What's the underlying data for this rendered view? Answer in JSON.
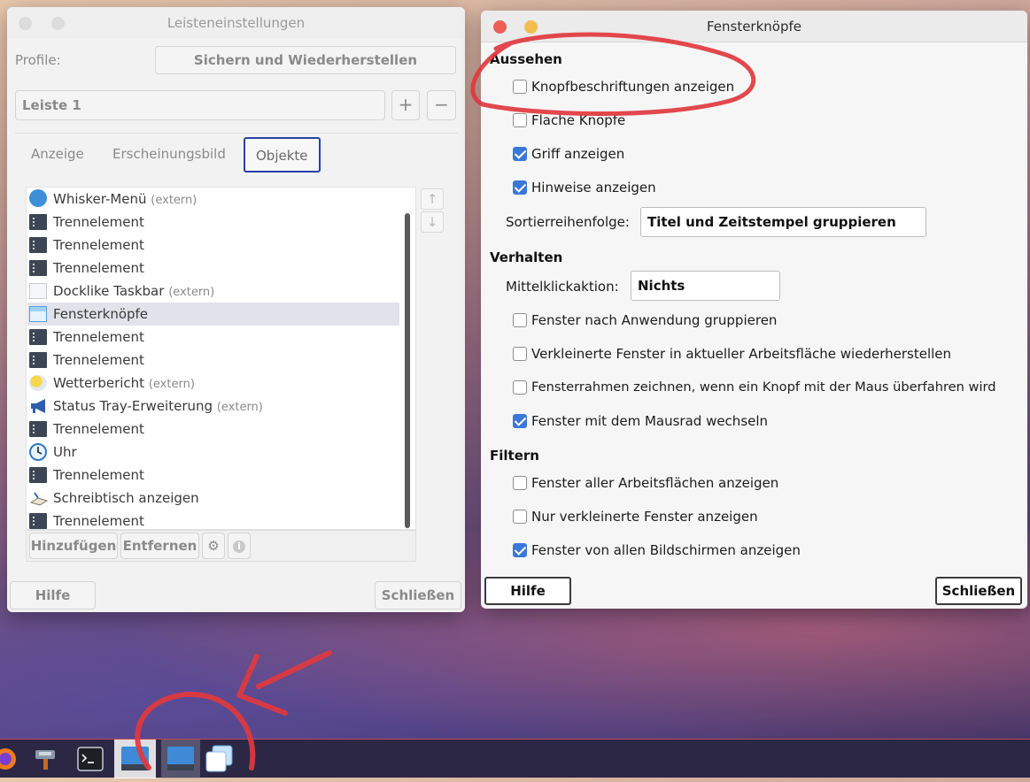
{
  "left_window": {
    "title": "Leisteneinstellungen",
    "profile_label": "Profile:",
    "backup_button": "Sichern und Wiederherstellen",
    "panel_select": "Leiste 1",
    "add_symbol": "+",
    "remove_symbol": "−",
    "tabs": [
      "Anzeige",
      "Erscheinungsbild",
      "Objekte"
    ],
    "active_tab": "Objekte",
    "items": [
      {
        "label": "Whisker-Menü",
        "extra": "(extern)",
        "icon": "whisker-menu-icon"
      },
      {
        "label": "Trennelement",
        "extra": "",
        "icon": "separator-icon"
      },
      {
        "label": "Trennelement",
        "extra": "",
        "icon": "separator-icon"
      },
      {
        "label": "Trennelement",
        "extra": "",
        "icon": "separator-icon"
      },
      {
        "label": "Docklike Taskbar",
        "extra": "(extern)",
        "icon": "taskbar-icon"
      },
      {
        "label": "Fensterknöpfe",
        "extra": "",
        "icon": "window-buttons-icon"
      },
      {
        "label": "Trennelement",
        "extra": "",
        "icon": "separator-icon"
      },
      {
        "label": "Trennelement",
        "extra": "",
        "icon": "separator-icon"
      },
      {
        "label": "Wetterbericht",
        "extra": "(extern)",
        "icon": "weather-icon"
      },
      {
        "label": "Status Tray-Erweiterung",
        "extra": "(extern)",
        "icon": "megaphone-icon"
      },
      {
        "label": "Trennelement",
        "extra": "",
        "icon": "separator-icon"
      },
      {
        "label": "Uhr",
        "extra": "",
        "icon": "clock-icon"
      },
      {
        "label": "Trennelement",
        "extra": "",
        "icon": "separator-icon"
      },
      {
        "label": "Schreibtisch anzeigen",
        "extra": "",
        "icon": "show-desktop-icon"
      },
      {
        "label": "Trennelement",
        "extra": "",
        "icon": "separator-icon"
      }
    ],
    "selected_item": "Fensterknöpfe",
    "add_item_button": "Hinzufügen",
    "remove_item_button": "Entfernen",
    "help_button": "Hilfe",
    "close_button": "Schließen"
  },
  "right_window": {
    "title": "Fensterknöpfe",
    "section_appearance": "Aussehen",
    "section_behavior": "Verhalten",
    "section_filter": "Filtern",
    "opt_button_labels": {
      "label": "Knopfbeschriftungen anzeigen",
      "checked": false
    },
    "opt_flat_buttons": {
      "label": "Flache Knöpfe",
      "checked": false
    },
    "opt_show_handle": {
      "label": "Griff anzeigen",
      "checked": true
    },
    "opt_show_tooltips": {
      "label": "Hinweise anzeigen",
      "checked": true
    },
    "sort_label": "Sortierreihenfolge:",
    "sort_value": "Titel und Zeitstempel gruppieren",
    "middle_click_label": "Mittelklickaktion:",
    "middle_click_value": "Nichts",
    "opt_group_windows": {
      "label": "Fenster nach Anwendung gruppieren",
      "checked": false
    },
    "opt_restore_minimized": {
      "label": "Verkleinerte Fenster in aktueller Arbeitsfläche wiederherstellen",
      "checked": false
    },
    "opt_draw_frames": {
      "label": "Fensterrahmen zeichnen, wenn ein Knopf mit der Maus überfahren wird",
      "checked": false
    },
    "opt_mouse_wheel": {
      "label": "Fenster mit dem Mausrad wechseln",
      "checked": true
    },
    "opt_all_workspaces": {
      "label": "Fenster aller Arbeitsflächen anzeigen",
      "checked": false
    },
    "opt_only_minimized": {
      "label": "Nur verkleinerte Fenster anzeigen",
      "checked": false
    },
    "opt_all_monitors": {
      "label": "Fenster von allen Bildschirmen anzeigen",
      "checked": true
    },
    "help_button": "Hilfe",
    "close_button": "Schließen"
  },
  "taskbar": {
    "items": [
      "firefox-icon",
      "settings-manager-icon",
      "terminal-icon",
      "panel-settings-icon",
      "panel-settings-icon",
      "window-buttons-icon"
    ]
  },
  "colors": {
    "accent": "#3a78d8",
    "close_light": "#ec5f56",
    "minimize_light": "#f3be4f",
    "annotation": "#e0383e",
    "tab_focus": "#2a3fa8"
  }
}
